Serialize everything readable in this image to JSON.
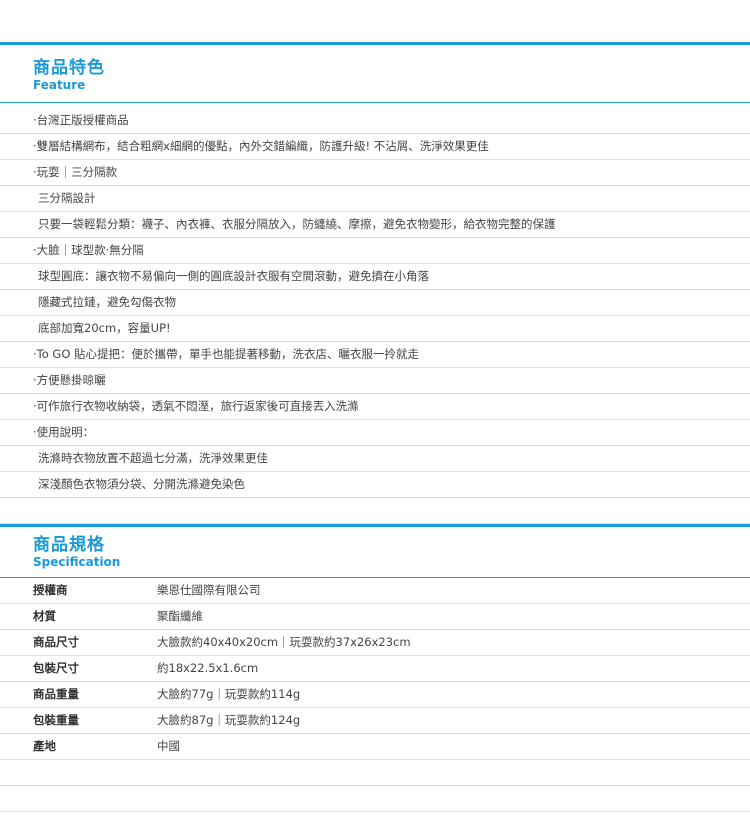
{
  "feature": {
    "title_zh": "商品特色",
    "title_en": "Feature",
    "items": [
      {
        "text": "‧台灣正版授權商品",
        "style": "bullet"
      },
      {
        "text": "‧雙層結構網布，結合粗網x細網的優點，內外交錯編織，防護升級! 不沾屑、洗淨效果更佳",
        "style": "bullet"
      },
      {
        "text": "‧玩耍｜三分隔款",
        "style": "bullet"
      },
      {
        "text": "三分隔設計",
        "style": "indent"
      },
      {
        "text": "只要一袋輕鬆分類：襪子、內衣褲、衣服分隔放入，防纏繞、摩擦，避免衣物變形，給衣物完整的保護",
        "style": "indent"
      },
      {
        "text": "‧大臉｜球型款‧無分隔",
        "style": "bullet"
      },
      {
        "text": "球型圓底：讓衣物不易偏向一側的圓底設計衣服有空間滾動，避免擠在小角落",
        "style": "indent"
      },
      {
        "text": "隱藏式拉鏈，避免勾傷衣物",
        "style": "indent"
      },
      {
        "text": "底部加寬20cm，容量UP!",
        "style": "indent"
      },
      {
        "text": "‧To GO 貼心提把：便於攜帶，單手也能提著移動，洗衣店、曬衣服一拎就走",
        "style": "bullet"
      },
      {
        "text": "‧方便懸掛晾曬",
        "style": "bullet"
      },
      {
        "text": "‧可作旅行衣物收納袋，透氣不悶溼，旅行返家後可直接丟入洗滌",
        "style": "bullet"
      },
      {
        "text": "‧使用說明：",
        "style": "bullet"
      },
      {
        "text": "洗滌時衣物放置不超過七分滿，洗淨效果更佳",
        "style": "indent"
      },
      {
        "text": "深淺顏色衣物須分袋、分開洗滌避免染色",
        "style": "indent"
      },
      {
        "text": "",
        "style": "empty"
      }
    ]
  },
  "spec": {
    "title_zh": "商品規格",
    "title_en": "Specification",
    "rows": [
      {
        "label": "授權商",
        "value": "樂恩仕國際有限公司"
      },
      {
        "label": "材質",
        "value": "聚酯纖維"
      },
      {
        "label": "商品尺寸",
        "value": "大臉款約40x40x20cm｜玩耍款約37x26x23cm"
      },
      {
        "label": "包裝尺寸",
        "value": "約18x22.5x1.6cm"
      },
      {
        "label": "商品重量",
        "value": "大臉約77g｜玩耍款約114g"
      },
      {
        "label": "包裝重量",
        "value": "大臉約87g｜玩耍款約124g"
      },
      {
        "label": "產地",
        "value": "中國"
      },
      {
        "label": "",
        "value": ""
      },
      {
        "label": "",
        "value": ""
      }
    ]
  },
  "colors": {
    "accent": "#1a9ad6",
    "divider": "#dddddd",
    "text": "#444444"
  }
}
